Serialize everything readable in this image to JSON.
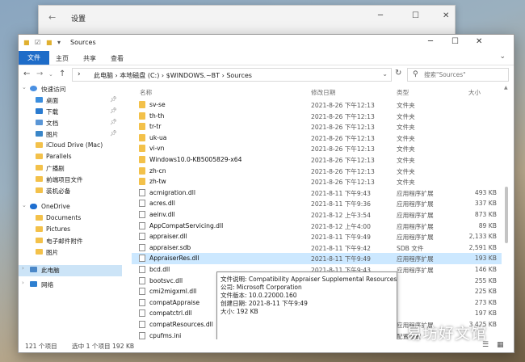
{
  "bg_window": {
    "title": "设置"
  },
  "titlebar": {
    "title": "Sources"
  },
  "ribbon": {
    "tabs": [
      "文件",
      "主页",
      "共享",
      "查看"
    ]
  },
  "address": {
    "crumbs": "此电脑 › 本地磁盘 (C:) › $WINDOWS.~BT › Sources"
  },
  "search": {
    "placeholder": "搜索\"Sources\""
  },
  "sidebar": {
    "items": [
      {
        "label": "快速访问",
        "icon": "star-icon"
      },
      {
        "label": "桌面",
        "icon": "desktop-icon"
      },
      {
        "label": "下载",
        "icon": "download-icon"
      },
      {
        "label": "文档",
        "icon": "document-icon"
      },
      {
        "label": "图片",
        "icon": "picture-icon"
      },
      {
        "label": "iCloud Drive (Mac)",
        "icon": "folder-icon"
      },
      {
        "label": "Parallels",
        "icon": "folder-icon"
      },
      {
        "label": "广播剧",
        "icon": "folder-icon"
      },
      {
        "label": "前端项目文件",
        "icon": "folder-icon"
      },
      {
        "label": "装机必备",
        "icon": "folder-icon"
      },
      {
        "label": "OneDrive",
        "icon": "cloud-icon"
      },
      {
        "label": "Documents",
        "icon": "folder-icon"
      },
      {
        "label": "Pictures",
        "icon": "folder-icon"
      },
      {
        "label": "电子邮件附件",
        "icon": "folder-icon"
      },
      {
        "label": "图片",
        "icon": "folder-icon"
      },
      {
        "label": "此电脑",
        "icon": "computer-icon"
      },
      {
        "label": "网络",
        "icon": "network-icon"
      }
    ]
  },
  "columns": {
    "name": "名称",
    "date": "修改日期",
    "type": "类型",
    "size": "大小"
  },
  "files": [
    {
      "name": "sv-se",
      "date": "2021-8-26 下午12:13",
      "type": "文件夹",
      "size": "",
      "kind": "folder"
    },
    {
      "name": "th-th",
      "date": "2021-8-26 下午12:13",
      "type": "文件夹",
      "size": "",
      "kind": "folder"
    },
    {
      "name": "tr-tr",
      "date": "2021-8-26 下午12:13",
      "type": "文件夹",
      "size": "",
      "kind": "folder"
    },
    {
      "name": "uk-ua",
      "date": "2021-8-26 下午12:13",
      "type": "文件夹",
      "size": "",
      "kind": "folder"
    },
    {
      "name": "vi-vn",
      "date": "2021-8-26 下午12:13",
      "type": "文件夹",
      "size": "",
      "kind": "folder"
    },
    {
      "name": "Windows10.0-KB5005829-x64",
      "date": "2021-8-26 下午12:13",
      "type": "文件夹",
      "size": "",
      "kind": "folder"
    },
    {
      "name": "zh-cn",
      "date": "2021-8-26 下午12:13",
      "type": "文件夹",
      "size": "",
      "kind": "folder"
    },
    {
      "name": "zh-tw",
      "date": "2021-8-26 下午12:13",
      "type": "文件夹",
      "size": "",
      "kind": "folder"
    },
    {
      "name": "acmigration.dll",
      "date": "2021-8-11 下午9:43",
      "type": "应用程序扩展",
      "size": "493 KB",
      "kind": "file"
    },
    {
      "name": "acres.dll",
      "date": "2021-8-11 下午9:36",
      "type": "应用程序扩展",
      "size": "337 KB",
      "kind": "file"
    },
    {
      "name": "aeinv.dll",
      "date": "2021-8-12 上午3:54",
      "type": "应用程序扩展",
      "size": "873 KB",
      "kind": "file"
    },
    {
      "name": "AppCompatServicing.dll",
      "date": "2021-8-12 上午4:00",
      "type": "应用程序扩展",
      "size": "89 KB",
      "kind": "file"
    },
    {
      "name": "appraiser.dll",
      "date": "2021-8-11 下午9:49",
      "type": "应用程序扩展",
      "size": "2,133 KB",
      "kind": "file"
    },
    {
      "name": "appraiser.sdb",
      "date": "2021-8-11 下午9:42",
      "type": "SDB 文件",
      "size": "2,591 KB",
      "kind": "file"
    },
    {
      "name": "AppraiserRes.dll",
      "date": "2021-8-11 下午9:49",
      "type": "应用程序扩展",
      "size": "193 KB",
      "kind": "file"
    },
    {
      "name": "bcd.dll",
      "date": "2021-8-11 下午9:43",
      "type": "应用程序扩展",
      "size": "146 KB",
      "kind": "file"
    },
    {
      "name": "bootsvc.dll",
      "date": "",
      "type": "",
      "size": "255 KB",
      "kind": "file"
    },
    {
      "name": "cmi2migxml.dll",
      "date": "",
      "type": "",
      "size": "225 KB",
      "kind": "file"
    },
    {
      "name": "compatAppraise",
      "date": "",
      "type": "",
      "size": "273 KB",
      "kind": "file"
    },
    {
      "name": "compatctrl.dll",
      "date": "",
      "type": "",
      "size": "197 KB",
      "kind": "file"
    },
    {
      "name": "compatResources.dll",
      "date": "2021-8-12 上午4:05",
      "type": "应用程序扩展",
      "size": "3,425 KB",
      "kind": "file"
    },
    {
      "name": "cpufms.ini",
      "date": "2021-8-11 下午6:09",
      "type": "配置设置",
      "size": "",
      "kind": "file"
    }
  ],
  "tooltip": {
    "line1": "文件说明: Compatibility Appraiser Supplemental Resources",
    "line2": "公司: Microsoft Corporation",
    "line3": "文件版本: 10.0.22000.160",
    "line4": "创建日期: 2021-8-11 下午9:49",
    "line5": "大小: 192 KB"
  },
  "status": {
    "count": "121 个项目",
    "selected": "选中 1 个项目  192 KB"
  },
  "watermark": "易坊好文馆"
}
